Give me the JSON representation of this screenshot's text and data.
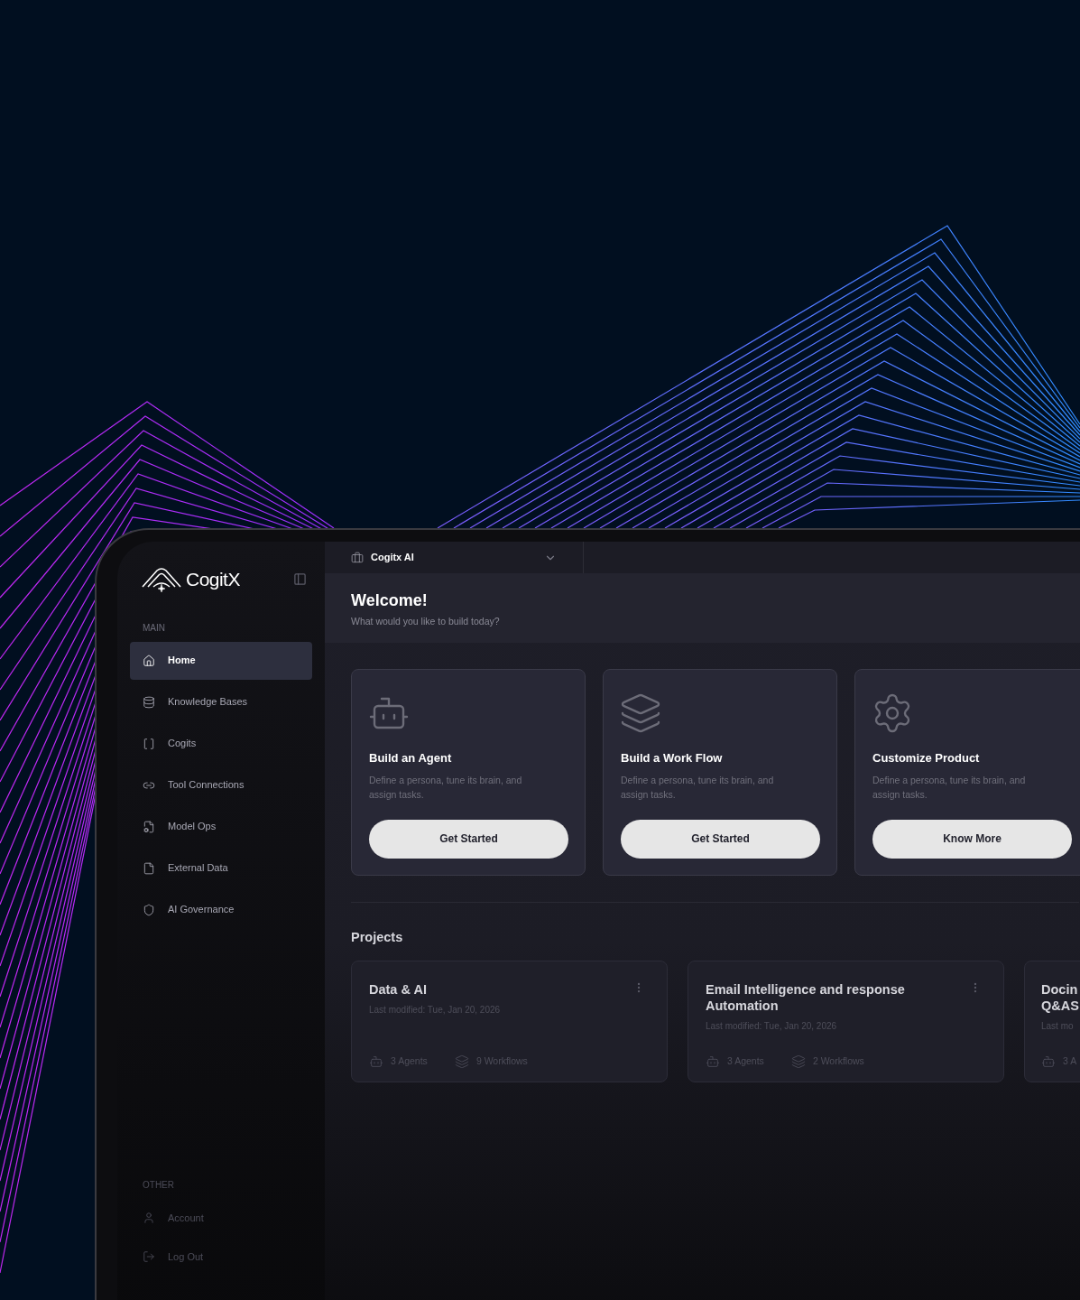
{
  "sidebar": {
    "brand": "CogitX",
    "sections": [
      {
        "title": "MAIN",
        "items": [
          {
            "label": "Home",
            "selected": true
          },
          {
            "label": "Knowledge Bases",
            "selected": false
          },
          {
            "label": "Cogits",
            "selected": false
          },
          {
            "label": "Tool Connections",
            "selected": false
          },
          {
            "label": "Model Ops",
            "selected": false
          },
          {
            "label": "External Data",
            "selected": false
          },
          {
            "label": "AI Governance",
            "selected": false
          }
        ]
      },
      {
        "title": "OTHER",
        "items": [
          {
            "label": "Account",
            "selected": false
          },
          {
            "label": "Log Out",
            "selected": false
          }
        ]
      }
    ]
  },
  "workspace_selector": {
    "value": "Cogitx AI"
  },
  "header": {
    "title": "Welcome!",
    "subtitle": "What would you like to build today?"
  },
  "action_cards": [
    {
      "kind": "agent",
      "title": "Build an Agent",
      "description": "Define a persona, tune its brain, and assign tasks.",
      "button": "Get Started"
    },
    {
      "kind": "workflow",
      "title": "Build a Work Flow",
      "description": "Define a persona, tune its brain, and assign tasks.",
      "button": "Get Started"
    },
    {
      "kind": "customize",
      "title": "Customize Product",
      "description": "Define a persona, tune its brain, and assign tasks.",
      "button": "Know More"
    }
  ],
  "projects": {
    "title": "Projects",
    "items": [
      {
        "title": "Data & AI",
        "modified": "Last modified: Tue, Jan 20, 2026",
        "agents": "3 Agents",
        "workflows": "9 Workflows"
      },
      {
        "title": "Email Intelligence and response Automation",
        "modified": "Last modified: Tue, Jan 20, 2026",
        "agents": "3 Agents",
        "workflows": "2 Workflows"
      },
      {
        "title": "Docin Q&AS",
        "modified": "Last mo",
        "agents": "3 A"
      }
    ]
  }
}
